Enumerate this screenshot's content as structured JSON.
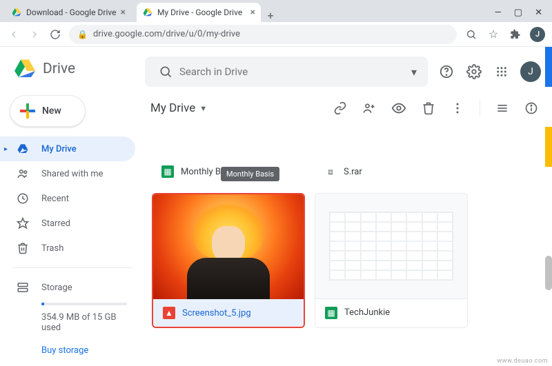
{
  "browser": {
    "tabs": [
      {
        "title": "Download - Google Drive"
      },
      {
        "title": "My Drive - Google Drive"
      }
    ],
    "url": "drive.google.com/drive/u/0/my-drive",
    "avatar_initial": "J"
  },
  "brand": {
    "name": "Drive"
  },
  "new_button": {
    "label": "New"
  },
  "sidebar": {
    "items": [
      {
        "label": "My Drive"
      },
      {
        "label": "Shared with me"
      },
      {
        "label": "Recent"
      },
      {
        "label": "Starred"
      },
      {
        "label": "Trash"
      }
    ],
    "storage": {
      "label": "Storage",
      "used_text": "354.9 MB of 15 GB used",
      "buy_label": "Buy storage"
    }
  },
  "search": {
    "placeholder": "Search in Drive"
  },
  "path": {
    "current": "My Drive"
  },
  "tooltip": {
    "text": "Monthly Basis"
  },
  "files_top": [
    {
      "name": "Monthly Basis",
      "kind": "sheets"
    },
    {
      "name": "S.rar",
      "kind": "zip"
    }
  ],
  "files_main": [
    {
      "name": "Screenshot_5.jpg",
      "kind": "image",
      "selected": true
    },
    {
      "name": "TechJunkie",
      "kind": "sheets",
      "selected": false
    }
  ],
  "watermark": "www.deuao.com"
}
